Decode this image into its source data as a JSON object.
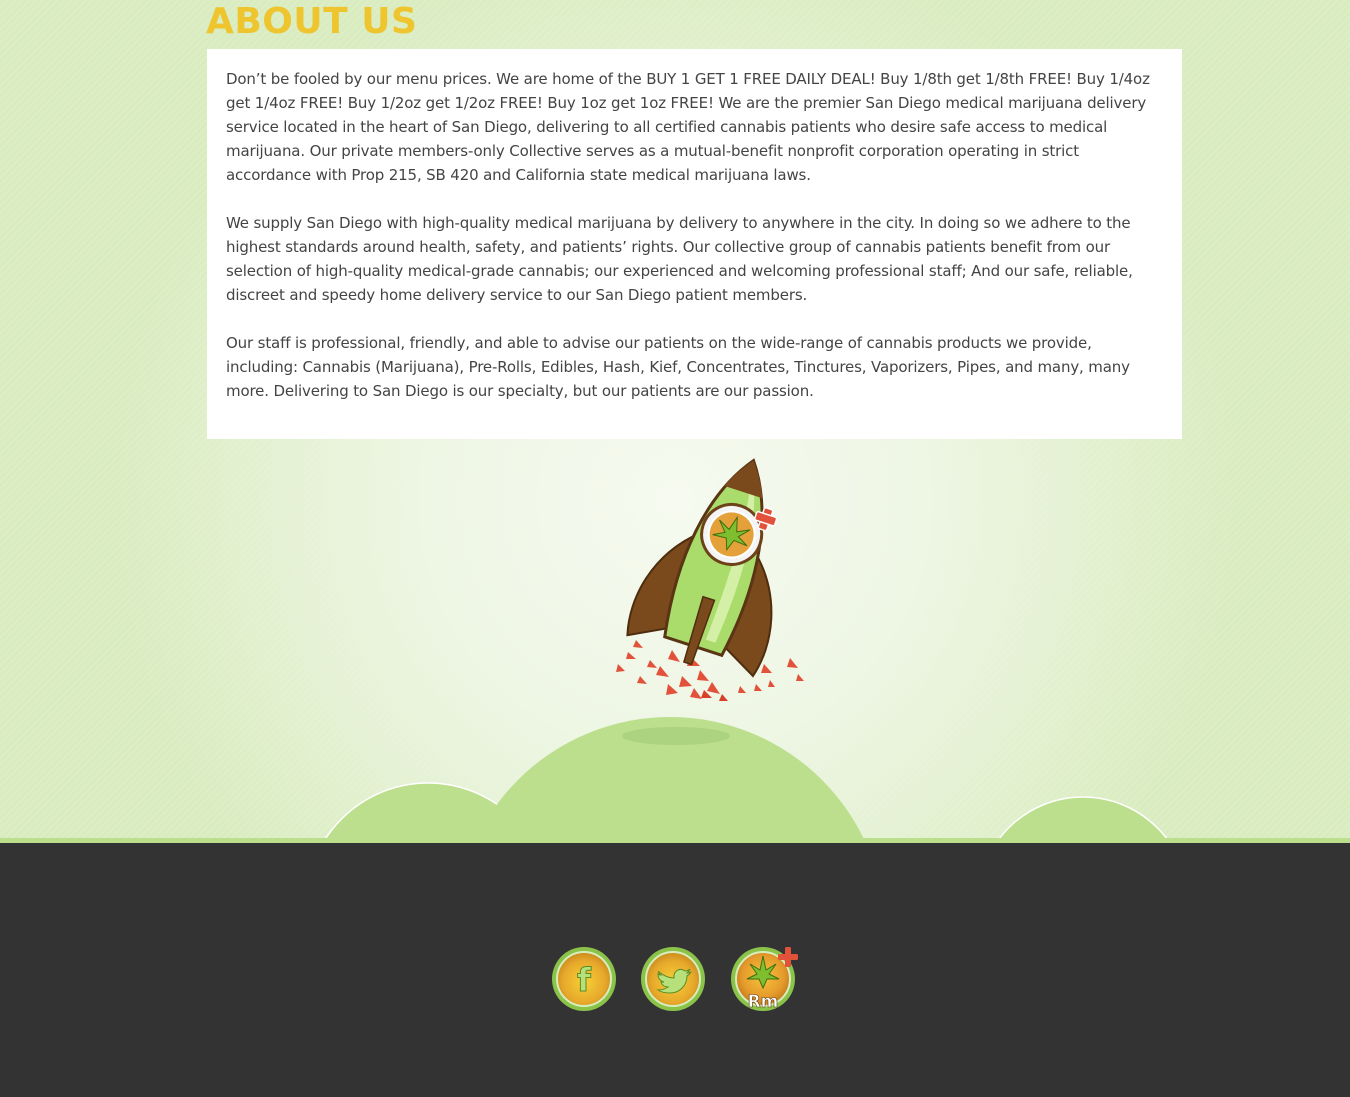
{
  "section": {
    "title": "ABOUT US"
  },
  "about": {
    "paragraphs": [
      "Don’t be fooled by our menu prices. We are home of the BUY 1 GET 1 FREE DAILY DEAL! Buy 1/8th get 1/8th FREE! Buy 1/4oz get 1/4oz FREE! Buy 1/2oz get 1/2oz FREE! Buy 1oz get 1oz FREE! We are the premier San Diego medical marijuana delivery service located in the heart of San Diego, delivering to all certified cannabis patients who desire safe access to medical marijuana. Our private members-only Collective serves as a mutual-benefit nonprofit corporation operating in strict accordance with Prop 215, SB 420 and California state medical marijuana laws.",
      "We supply San Diego with high-quality medical marijuana by delivery to anywhere in the city. In doing so we adhere to the highest standards around health, safety, and patients’ rights. Our collective group of cannabis patients benefit from our selection of high-quality medical-grade cannabis; our experienced and welcoming professional staff; And our safe, reliable, discreet and speedy home delivery service to our San Diego patient members.",
      "Our staff is professional, friendly, and able to advise our patients on the wide-range of cannabis products we provide, including: Cannabis (Marijuana), Pre-Rolls, Edibles, Hash, Kief, Concentrates, Tinctures, Vaporizers, Pipes, and many, many more. Delivering to San Diego is our specialty, but our patients are our passion."
    ]
  },
  "illustration": {
    "icon": "rocket-icon"
  },
  "footer": {
    "social": [
      {
        "icon": "facebook-icon",
        "label": "f"
      },
      {
        "icon": "twitter-icon",
        "label": ""
      },
      {
        "icon": "rm-icon",
        "label": "Rm"
      }
    ]
  },
  "colors": {
    "title": "#efc52f",
    "hill": "#bcdf8d",
    "footer": "#333333",
    "page_bg": "#d9ecbf"
  }
}
